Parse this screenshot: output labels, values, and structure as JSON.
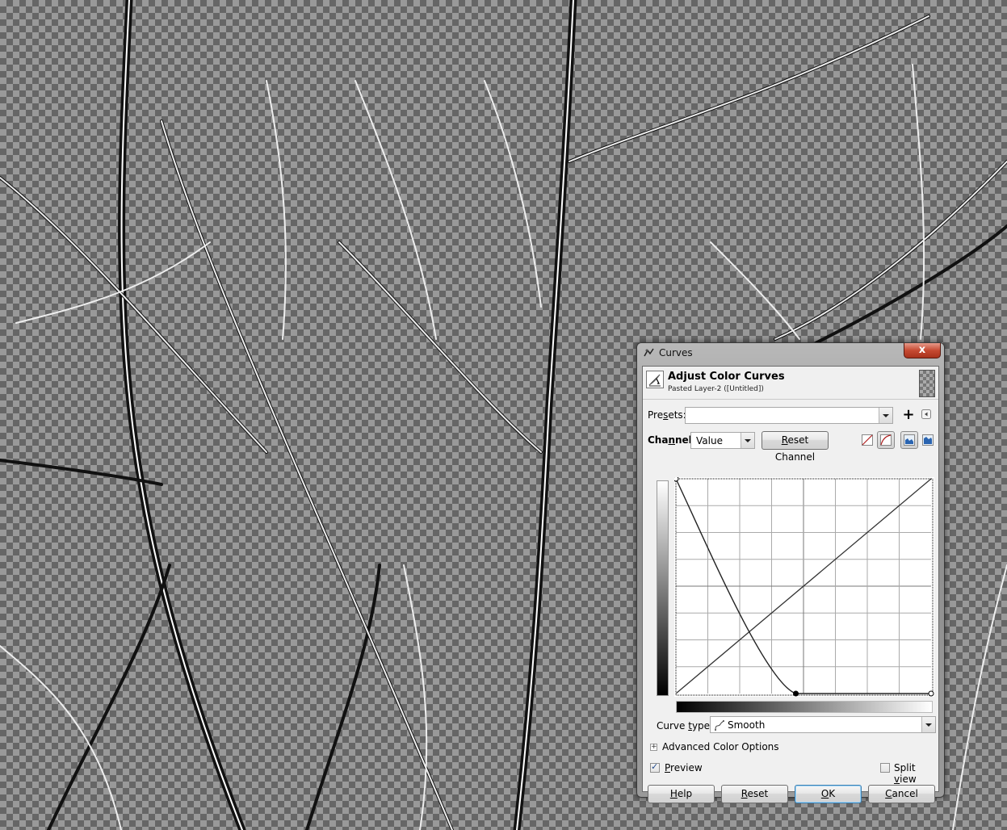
{
  "dialog": {
    "window_title": "Curves",
    "close_label": "x",
    "header": {
      "title": "Adjust Color Curves",
      "subtitle": "Pasted Layer-2 ([Untitled])"
    },
    "presets": {
      "label_pre": "Pre",
      "label_mnemonic": "s",
      "label_post": "ets:",
      "value": "",
      "add_icon": "plus-icon",
      "menu_icon": "left-arrow-icon"
    },
    "channel": {
      "label_pre": "Cha",
      "label_mnemonic": "n",
      "label_post": "nel:",
      "value": "Value",
      "reset_pre": "",
      "reset_mnemonic": "R",
      "reset_post": "eset Channel",
      "icons": [
        "linear-histogram-icon",
        "logarithmic-histogram-icon",
        "histogram-view-icon",
        "histogram-view-alt-icon"
      ]
    },
    "curve": {
      "grid_divisions": 8,
      "curve_points": [
        [
          0,
          1.0
        ],
        [
          0.47,
          0.0
        ],
        [
          1.0,
          0.0
        ]
      ],
      "reference_line": [
        [
          0,
          0
        ],
        [
          1,
          1
        ]
      ]
    },
    "curve_type": {
      "label_pre": "Curve ",
      "label_mnemonic": "t",
      "label_post": "ype:",
      "value": "Smooth",
      "icon": "smooth-curve-icon"
    },
    "advanced": {
      "label": "Advanced Color Options",
      "expander": "+"
    },
    "preview": {
      "label_mnemonic": "P",
      "label_post": "review",
      "checked": true
    },
    "split_view": {
      "label_pre": "Split ",
      "label_mnemonic": "v",
      "label_post": "iew",
      "checked": false
    },
    "buttons": {
      "help": {
        "mnemonic": "H",
        "rest": "elp"
      },
      "reset": {
        "mnemonic": "R",
        "rest": "eset"
      },
      "ok": {
        "mnemonic": "O",
        "rest": "K"
      },
      "cancel": {
        "mnemonic": "C",
        "rest": "ancel"
      }
    }
  },
  "check_mark": "✓",
  "colors": {
    "close_button": "#c64a32",
    "default_button_border": "#3c7fb1",
    "icon_red": "#b02020"
  }
}
